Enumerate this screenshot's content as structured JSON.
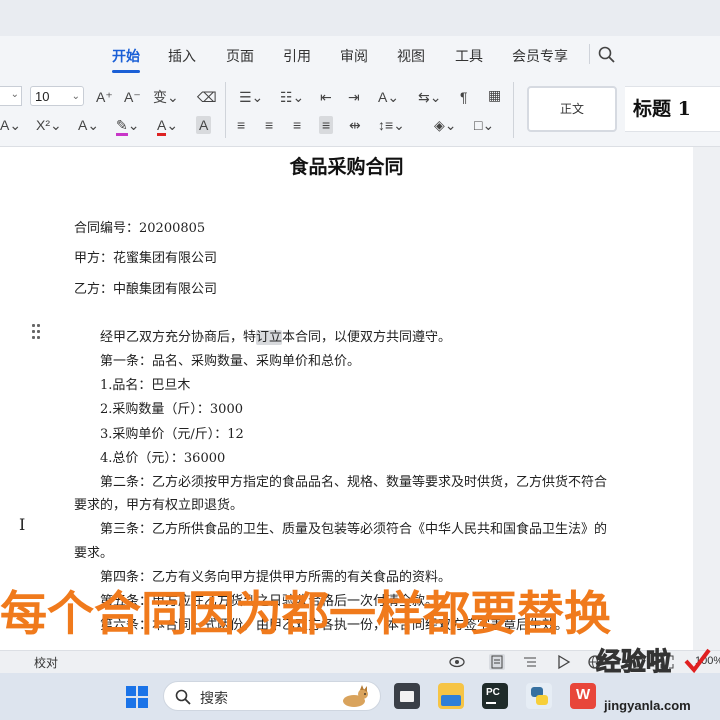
{
  "ribbon": {
    "tabs": [
      "开始",
      "插入",
      "页面",
      "引用",
      "审阅",
      "视图",
      "工具",
      "会员专享"
    ],
    "active_tab": "开始"
  },
  "toolbar": {
    "font_size": "10",
    "styles": {
      "normal": "正文",
      "heading1": "标题 1"
    }
  },
  "document": {
    "title": "食品采购合同",
    "header_lines": [
      "合同编号：20200805",
      "甲方：花蜜集团有限公司",
      "乙方：中酿集团有限公司"
    ],
    "intro": "经甲乙双方充分协商后，特订立本合同，以便双方共同遵守。",
    "intro_highlight": "订立",
    "body_lines": [
      "第一条：品名、采购数量、采购单价和总价。",
      "1.品名：巴旦木",
      "2.采购数量（斤）：3000",
      "3.采购单价（元/斤）：12",
      "4.总价（元）：36000",
      "第二条：乙方必须按甲方指定的食品品名、规格、数量等要求及时供货，乙方供货不符合",
      "要求的，甲方有权立即退货。",
      "第三条：乙方所供食品的卫生、质量及包装等必须符合《中华人民共和国食品卫生法》的",
      "要求。",
      "第四条：乙方有义务向甲方提供甲方所需的有关食品的资料。",
      "第五条：甲方应在乙方货到之日验收合格后一次付清全款。",
      "第六条：本合同一式两份，由甲乙双方各执一份，本合同经双方签字盖章后生效。"
    ]
  },
  "overlay_caption": "每个合同因为都一样都要替换",
  "statusbar": {
    "proofread": "校对",
    "zoom": "100%"
  },
  "taskbar": {
    "search_placeholder": "搜索"
  },
  "watermark": {
    "main": "经验啦",
    "sub": "jingyanla.com"
  }
}
